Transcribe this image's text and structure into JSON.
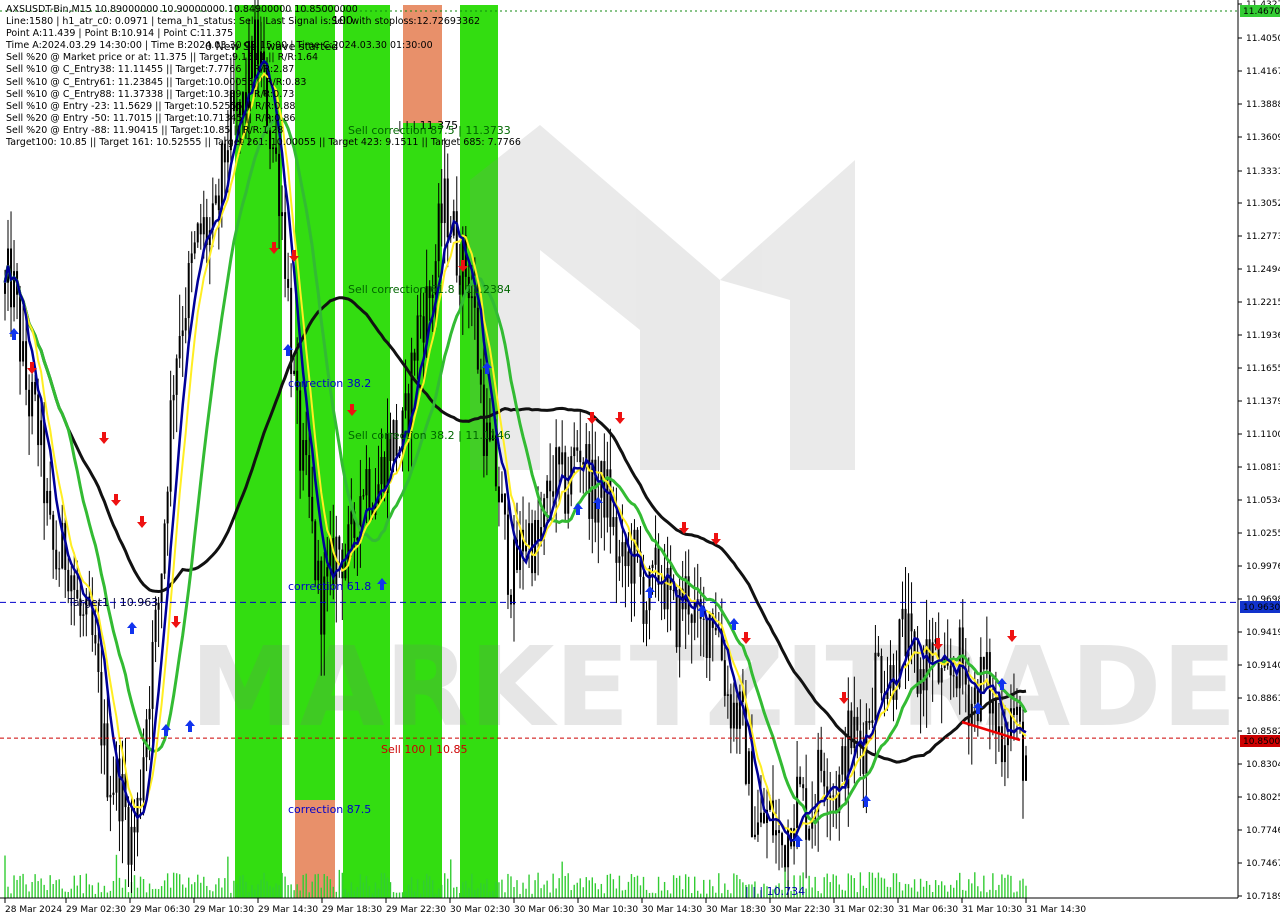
{
  "info_lines": [
    "AXSUSDT-Bin,M15  10.89000000 10.90000000 10.84900000 10.85000000",
    "Line:1580  |  h1_atr_c0: 0.0971  |  tema_h1_status: Sell  |  Last Signal is:Sell with stoploss:12.72693362",
    "Point A:11.439  |  Point B:10.914  |  Point C:11.375",
    "Time A:2024.03.29 14:30:00  |  Time B:2024.03.30 09:15:00  |  Time C:2024.03.30 01:30:00",
    "Sell %20 @ Market price or at: 11.375  ||  Target:9.1511  ||  R/R:1.64",
    "Sell %10 @ C_Entry38: 11.11455  ||  Target:7.7766  ||  R/R:2.87",
    "Sell %10 @ C_Entry61: 11.23845  ||  Target:10.00055  ||  R/R:0.83",
    "Sell %10 @ C_Entry88: 11.37338  ||  Target:10.389  ||  R/R:0.73",
    "Sell %10 @ Entry -23: 11.5629  ||  Target:10.52555  ||  R/R:0.88",
    "Sell %20 @ Entry -50: 11.7015  ||  Target:10.71345  ||  R/R:0.86",
    "Sell %20 @ Entry -88: 11.90415  ||  Target:10.85  ||  R/R:1.28",
    "Target100: 10.85  ||  Target 161: 10.52555  ||  Target 261: 10.00055  ||  Target 423: 9.1511  ||  Target 685: 7.7766"
  ],
  "price_ticks": [
    "11.4327",
    "11.4050",
    "11.4167",
    "11.3888",
    "11.3609",
    "11.3331",
    "11.3052",
    "11.2773",
    "11.2494",
    "11.2215",
    "11.1936",
    "11.1655",
    "11.1379",
    "11.1100",
    "11.0813",
    "11.0534",
    "11.0255",
    "10.9976",
    "10.9698",
    "10.9419",
    "10.9140",
    "10.8861",
    "10.8582",
    "10.8304",
    "10.8025",
    "10.7746",
    "10.7467",
    "10.7189"
  ],
  "time_ticks": [
    "28 Mar 2024",
    "29 Mar 02:30",
    "29 Mar 06:30",
    "29 Mar 10:30",
    "29 Mar 14:30",
    "29 Mar 18:30",
    "29 Mar 22:30",
    "30 Mar 02:30",
    "30 Mar 06:30",
    "30 Mar 10:30",
    "30 Mar 14:30",
    "30 Mar 18:30",
    "30 Mar 22:30",
    "31 Mar 02:30",
    "31 Mar 06:30",
    "31 Mar 10:30",
    "31 Mar 14:30"
  ],
  "price_labels": {
    "top": "11.4670",
    "mid": "10.9630",
    "bottom": "10.8500"
  },
  "annotations": {
    "new_sell_wave": "0 New Sell wave started",
    "label_100": "100",
    "point_c": "| | | 11.375",
    "sell_corr_87": "Sell correction 87.5 | 11.3733",
    "sell_corr_61": "Sell correction 61.8 | 11.2384",
    "sell_corr_38": "Sell correction 38.2 | 11.1146",
    "corr_382": "correction 38.2",
    "corr_618": "correction 61.8",
    "corr_875": "correction 87.5",
    "target1": "Target1 | 10.963",
    "sell100": "Sell 100 | 10.85",
    "low": "| | | 10.734",
    "watermark": "MARKETZITRADE"
  },
  "colors": {
    "bull": "#000000",
    "green_zone": "#33dd11",
    "orange_zone": "#e8906a",
    "ma_fast": "#000099",
    "ma_yellow": "#ffee22",
    "ma_green": "#33bb33",
    "ma_slow": "#111111",
    "level_blue": "#0000cc",
    "level_red": "#cc0000",
    "volume": "#33cc33",
    "arrow_up": "#1133ee",
    "arrow_down": "#ee1111"
  },
  "chart_data": {
    "type": "candlestick",
    "symbol": "AXSUSDT-Bin",
    "timeframe": "M15",
    "ylim": [
      10.7189,
      11.4327
    ],
    "levels": [
      {
        "name": "Target1",
        "value": 10.963,
        "color": "blue",
        "style": "dashed"
      },
      {
        "name": "Sell 100",
        "value": 10.85,
        "color": "red",
        "style": "dashed"
      },
      {
        "name": "top",
        "value": 11.467,
        "color": "green",
        "style": "dotted"
      }
    ],
    "points": {
      "A": 11.439,
      "B": 10.914,
      "C": 11.375,
      "low": 10.734
    },
    "last_close": 10.85,
    "close_path": [
      {
        "x": "28 Mar 2024",
        "y": 11.22
      },
      {
        "x": "29 Mar 02:30",
        "y": 10.99
      },
      {
        "x": "29 Mar 06:30",
        "y": 10.78
      },
      {
        "x": "29 Mar 10:30",
        "y": 11.25
      },
      {
        "x": "29 Mar 14:30",
        "y": 11.41
      },
      {
        "x": "29 Mar 18:30",
        "y": 10.98
      },
      {
        "x": "29 Mar 22:30",
        "y": 11.08
      },
      {
        "x": "30 Mar 02:30",
        "y": 11.28
      },
      {
        "x": "30 Mar 06:30",
        "y": 11.0
      },
      {
        "x": "30 Mar 10:30",
        "y": 11.08
      },
      {
        "x": "30 Mar 14:30",
        "y": 10.98
      },
      {
        "x": "30 Mar 18:30",
        "y": 10.95
      },
      {
        "x": "30 Mar 22:30",
        "y": 10.77
      },
      {
        "x": "31 Mar 02:30",
        "y": 10.82
      },
      {
        "x": "31 Mar 06:30",
        "y": 10.92
      },
      {
        "x": "31 Mar 10:30",
        "y": 10.9
      },
      {
        "x": "31 Mar 14:30",
        "y": 10.85
      }
    ],
    "moving_averages": [
      {
        "name": "tema",
        "color": "#000099"
      },
      {
        "name": "yellow",
        "color": "#ffee22"
      },
      {
        "name": "green",
        "color": "#33bb33"
      },
      {
        "name": "slow",
        "color": "#111111"
      }
    ]
  }
}
